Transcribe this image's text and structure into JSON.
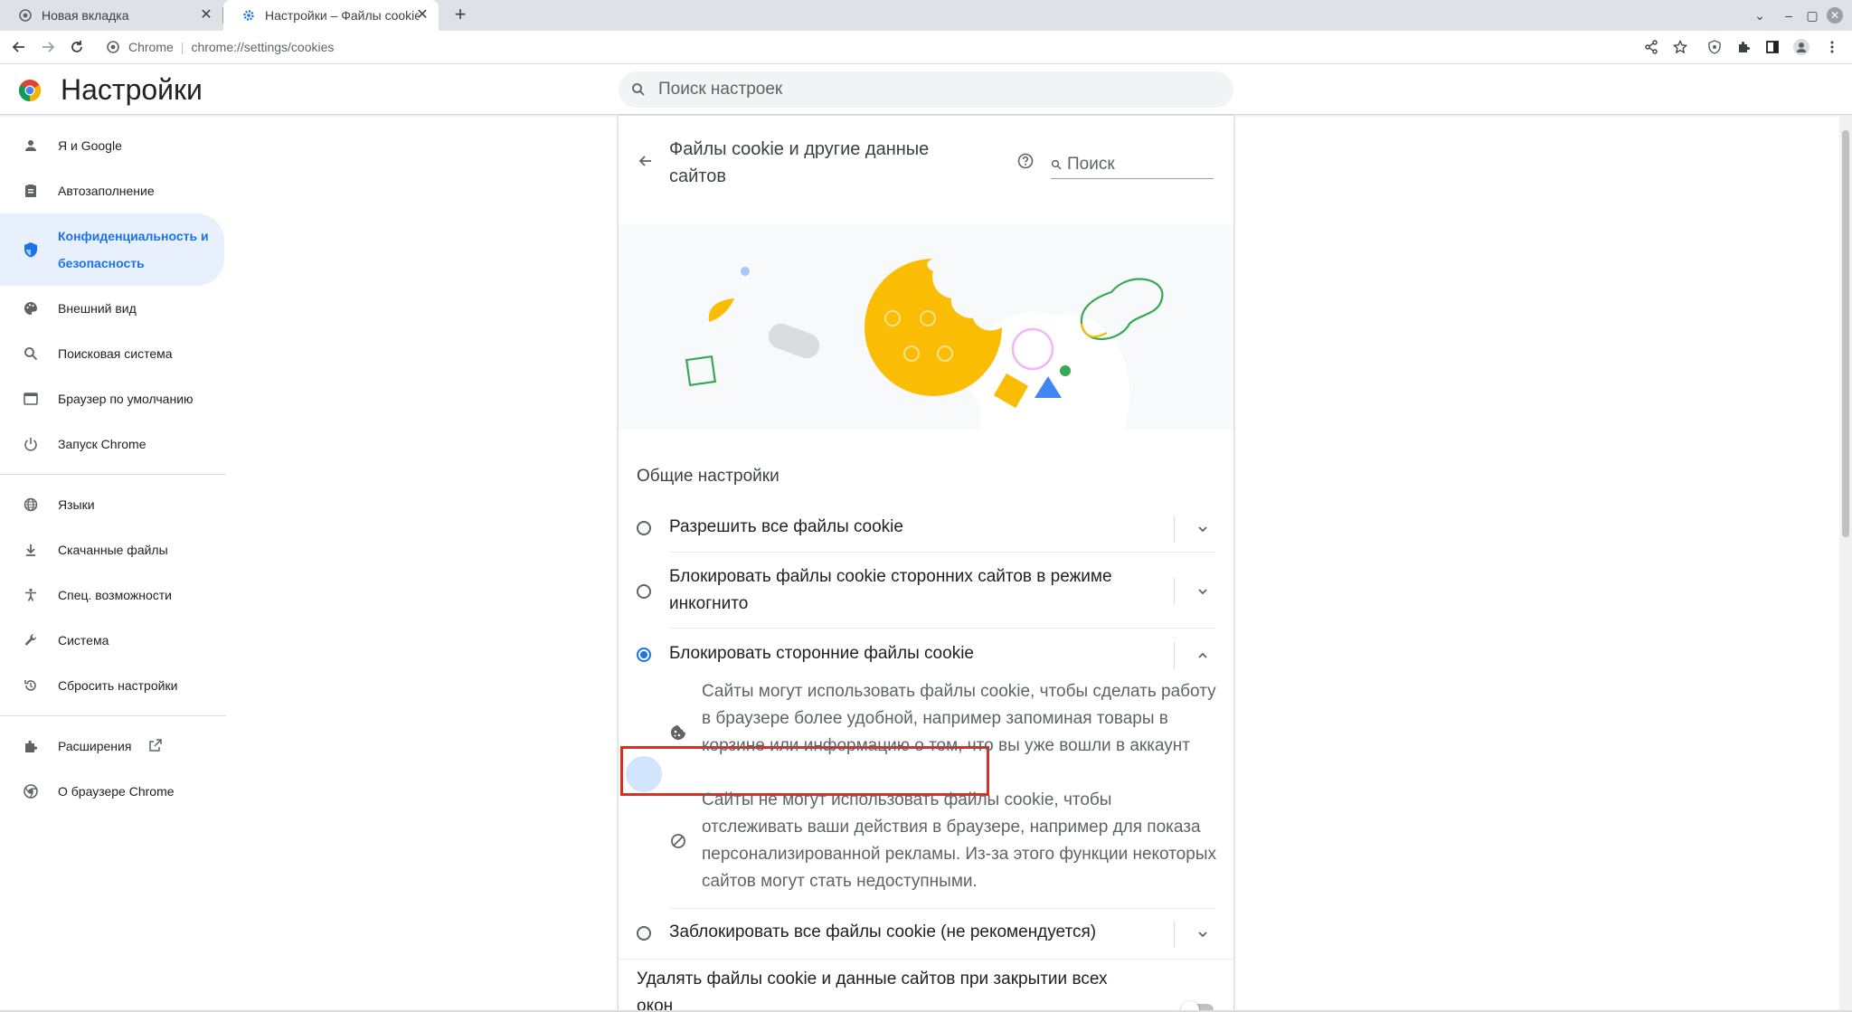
{
  "browser": {
    "tabs": [
      {
        "title": "Новая вкладка",
        "close": "✕"
      },
      {
        "title": "Настройки – Файлы cookie и",
        "close": "✕"
      }
    ],
    "new_tab_label": "+",
    "omnibox": {
      "chip": "Chrome",
      "separator": "|",
      "url": "chrome://settings/cookies"
    },
    "window_controls": {
      "menu": "⌄",
      "minimize": "–",
      "restore": "▢",
      "close": "✕"
    }
  },
  "header": {
    "title": "Настройки",
    "search_placeholder": "Поиск настроек"
  },
  "sidebar": {
    "items": [
      {
        "label": "Я и Google",
        "icon": "person-icon"
      },
      {
        "label": "Автозаполнение",
        "icon": "clipboard-icon"
      },
      {
        "label": "Конфиденциальность и безопасность",
        "icon": "shield-icon",
        "active": true
      },
      {
        "label": "Внешний вид",
        "icon": "palette-icon"
      },
      {
        "label": "Поисковая система",
        "icon": "search-icon"
      },
      {
        "label": "Браузер по умолчанию",
        "icon": "browser-icon"
      },
      {
        "label": "Запуск Chrome",
        "icon": "power-icon"
      },
      {
        "label": "Языки",
        "icon": "globe-icon"
      },
      {
        "label": "Скачанные файлы",
        "icon": "download-icon"
      },
      {
        "label": "Спец. возможности",
        "icon": "accessibility-icon"
      },
      {
        "label": "Система",
        "icon": "wrench-icon"
      },
      {
        "label": "Сбросить настройки",
        "icon": "reset-icon"
      },
      {
        "label": "Расширения",
        "icon": "puzzle-icon"
      },
      {
        "label": "О браузере Chrome",
        "icon": "chrome-icon"
      }
    ]
  },
  "page": {
    "title": "Файлы cookie и другие данные сайтов",
    "search_placeholder": "Поиск",
    "section_title": "Общие настройки",
    "options": [
      {
        "label": "Разрешить все файлы cookie",
        "selected": false
      },
      {
        "label": "Блокировать файлы cookie сторонних сайтов в режиме инкогнито",
        "selected": false
      },
      {
        "label": "Блокировать сторонние файлы cookie",
        "selected": true
      },
      {
        "label": "Заблокировать все файлы cookie (не рекомендуется)",
        "selected": false
      }
    ],
    "expanded_details": [
      {
        "icon": "cookie-icon",
        "text": "Сайты могут использовать файлы cookie, чтобы сделать работу в браузере более удобной, например запоминая товары в корзине или информацию о том, что вы уже вошли в аккаунт"
      },
      {
        "icon": "block-icon",
        "text": "Сайты не могут использовать файлы cookie, чтобы отслеживать ваши действия в браузере, например для показа персонализированной рекламы. Из-за этого функции некоторых сайтов могут стать недоступными."
      }
    ],
    "clear_on_exit_label": "Удалять файлы cookie и данные сайтов при закрытии всех окон",
    "clear_on_exit_enabled": false
  },
  "colors": {
    "accent": "#1a73e8",
    "highlight_box": "#d93025",
    "cookie": "#fbbc04",
    "green": "#34a853",
    "blue": "#4285f4"
  }
}
